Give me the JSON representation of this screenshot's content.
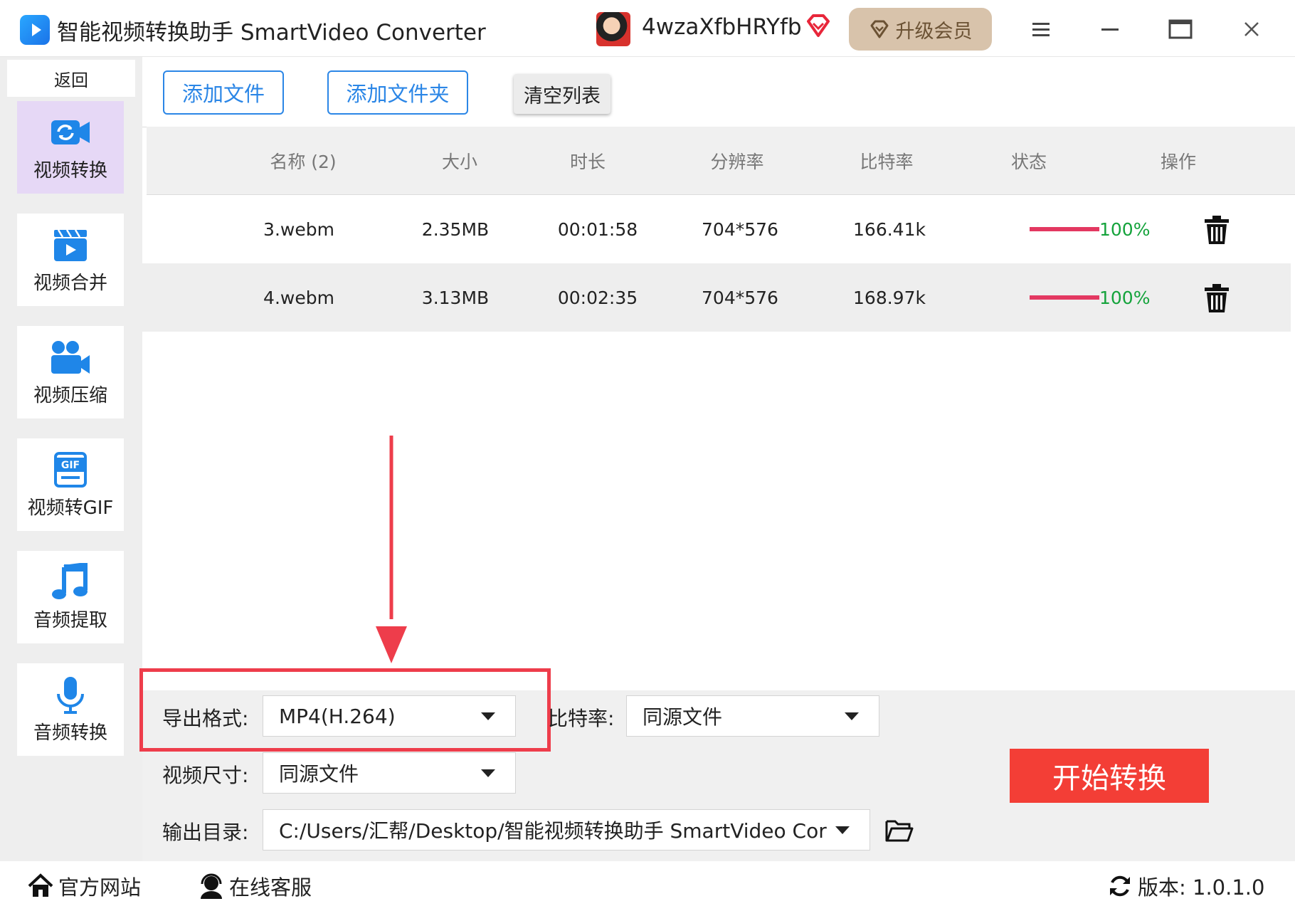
{
  "app": {
    "title": "智能视频转换助手 SmartVideo Converter",
    "username": "4wzaXfbHRYfb",
    "upgrade_label": "升级会员"
  },
  "sidebar": {
    "back_label": "返回",
    "items": [
      {
        "label": "视频转换",
        "icon": "video-convert-icon",
        "active": true
      },
      {
        "label": "视频合并",
        "icon": "video-merge-icon",
        "active": false
      },
      {
        "label": "视频压缩",
        "icon": "video-compress-icon",
        "active": false
      },
      {
        "label": "视频转GIF",
        "icon": "gif-icon",
        "active": false
      },
      {
        "label": "音频提取",
        "icon": "music-note-icon",
        "active": false
      },
      {
        "label": "音频转换",
        "icon": "microphone-icon",
        "active": false
      }
    ]
  },
  "toolbar": {
    "add_file": "添加文件",
    "add_folder": "添加文件夹",
    "clear_list": "清空列表"
  },
  "table": {
    "headers": [
      "名称 (2)",
      "大小",
      "时长",
      "分辨率",
      "比特率",
      "状态",
      "操作"
    ],
    "rows": [
      {
        "name": "3.webm",
        "size": "2.35MB",
        "duration": "00:01:58",
        "resolution": "704*576",
        "bitrate": "166.41k",
        "status": "100%",
        "progress": 1.0
      },
      {
        "name": "4.webm",
        "size": "3.13MB",
        "duration": "00:02:35",
        "resolution": "704*576",
        "bitrate": "168.97k",
        "status": "100%",
        "progress": 1.0
      }
    ]
  },
  "settings": {
    "format_label": "导出格式:",
    "format_value": "MP4(H.264)",
    "bitrate_label": "比特率:",
    "bitrate_value": "同源文件",
    "size_label": "视频尺寸:",
    "size_value": "同源文件",
    "output_label": "输出目录:",
    "output_value": "C:/Users/汇帮/Desktop/智能视频转换助手 SmartVideo Cor"
  },
  "start_label": "开始转换",
  "footer": {
    "website": "官方网站",
    "support": "在线客服",
    "version": "版本: 1.0.1.0"
  },
  "colors": {
    "accent": "#2b86e6",
    "start": "#f33e36",
    "progress": "#e33861",
    "status_text": "#15a33c",
    "highlight": "#ee3d4b",
    "vip": "#d8c3ab"
  }
}
